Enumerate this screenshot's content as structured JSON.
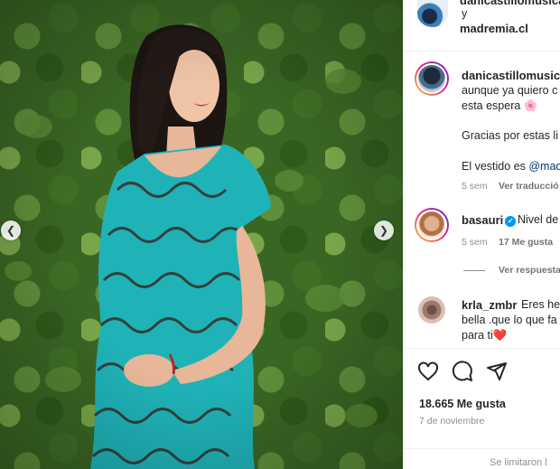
{
  "header": {
    "username_partial": "danicastillomusica",
    "and_text": "y",
    "collab_account": "madremia.cl"
  },
  "caption": {
    "username": "danicastillomusica",
    "line1": "aunque ya quiero c",
    "line2": "esta espera",
    "line2_emoji": "🌸",
    "line3": "Gracias por estas li",
    "line4_prefix": "El vestido es ",
    "line4_mention": "@mad",
    "time": "5 sem",
    "translate": "Ver traducció"
  },
  "comments": [
    {
      "username": "basauri",
      "verified": true,
      "text": "Nivel de",
      "time": "5 sem",
      "likes": "17 Me gusta",
      "replies": "Ver respuesta"
    },
    {
      "username": "krla_zmbr",
      "text_line1": "Eres her",
      "text_line2": "bella .que lo que fa",
      "text_line3": "para ti",
      "emoji": "❤️"
    }
  ],
  "actions": {
    "like_icon": "heart-icon",
    "comment_icon": "comment-icon",
    "share_icon": "share-icon"
  },
  "likes_count": "18.665 Me gusta",
  "post_date": "7 de noviembre",
  "footer_note": "Se limitaron l",
  "colors": {
    "dress": "#1fb3b8",
    "foliage": "#3a6623",
    "verified": "#0095f6"
  }
}
